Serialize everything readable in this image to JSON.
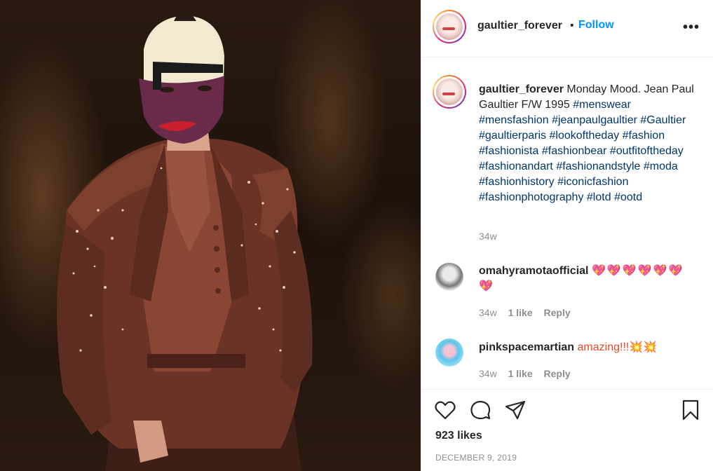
{
  "post": {
    "image_alt": "Model wearing a burgundy sequined suit and a mask on a runway"
  },
  "header": {
    "username": "gaultier_forever",
    "separator": "•",
    "follow_label": "Follow",
    "more_label": "•••"
  },
  "caption": {
    "username": "gaultier_forever",
    "text": " Monday Mood. Jean Paul Gaultier F/W 1995 ",
    "hashtags": [
      "#menswear",
      "#mensfashion",
      "#jeanpaulgaultier",
      "#Gaultier",
      "#gaultierparis",
      "#lookoftheday",
      "#fashion",
      "#fashionista",
      "#fashionbear",
      "#outfitoftheday",
      "#fashionandart",
      "#fashionandstyle",
      "#moda",
      "#fashionhistory",
      "#iconicfashion",
      "#fashionphotography",
      "#lotd",
      "#ootd"
    ],
    "time": "34w"
  },
  "comments": [
    {
      "username": "omahyramotaofficial",
      "text": "💖💖💖💖💖💖💖",
      "time": "34w",
      "likes": "1 like",
      "reply": "Reply"
    },
    {
      "username": "pinkspacemartian",
      "text": "amazing!!!💥💥",
      "time": "34w",
      "likes": "1 like",
      "reply": "Reply"
    }
  ],
  "actions": {
    "like_icon": "heart-icon",
    "comment_icon": "comment-icon",
    "share_icon": "send-icon",
    "save_icon": "bookmark-icon"
  },
  "likes_count": "923 likes",
  "date": "DECEMBER 9, 2019",
  "colors": {
    "link_blue": "#0095f6",
    "hashtag": "#00376b",
    "secondary": "#8e8e8e"
  }
}
